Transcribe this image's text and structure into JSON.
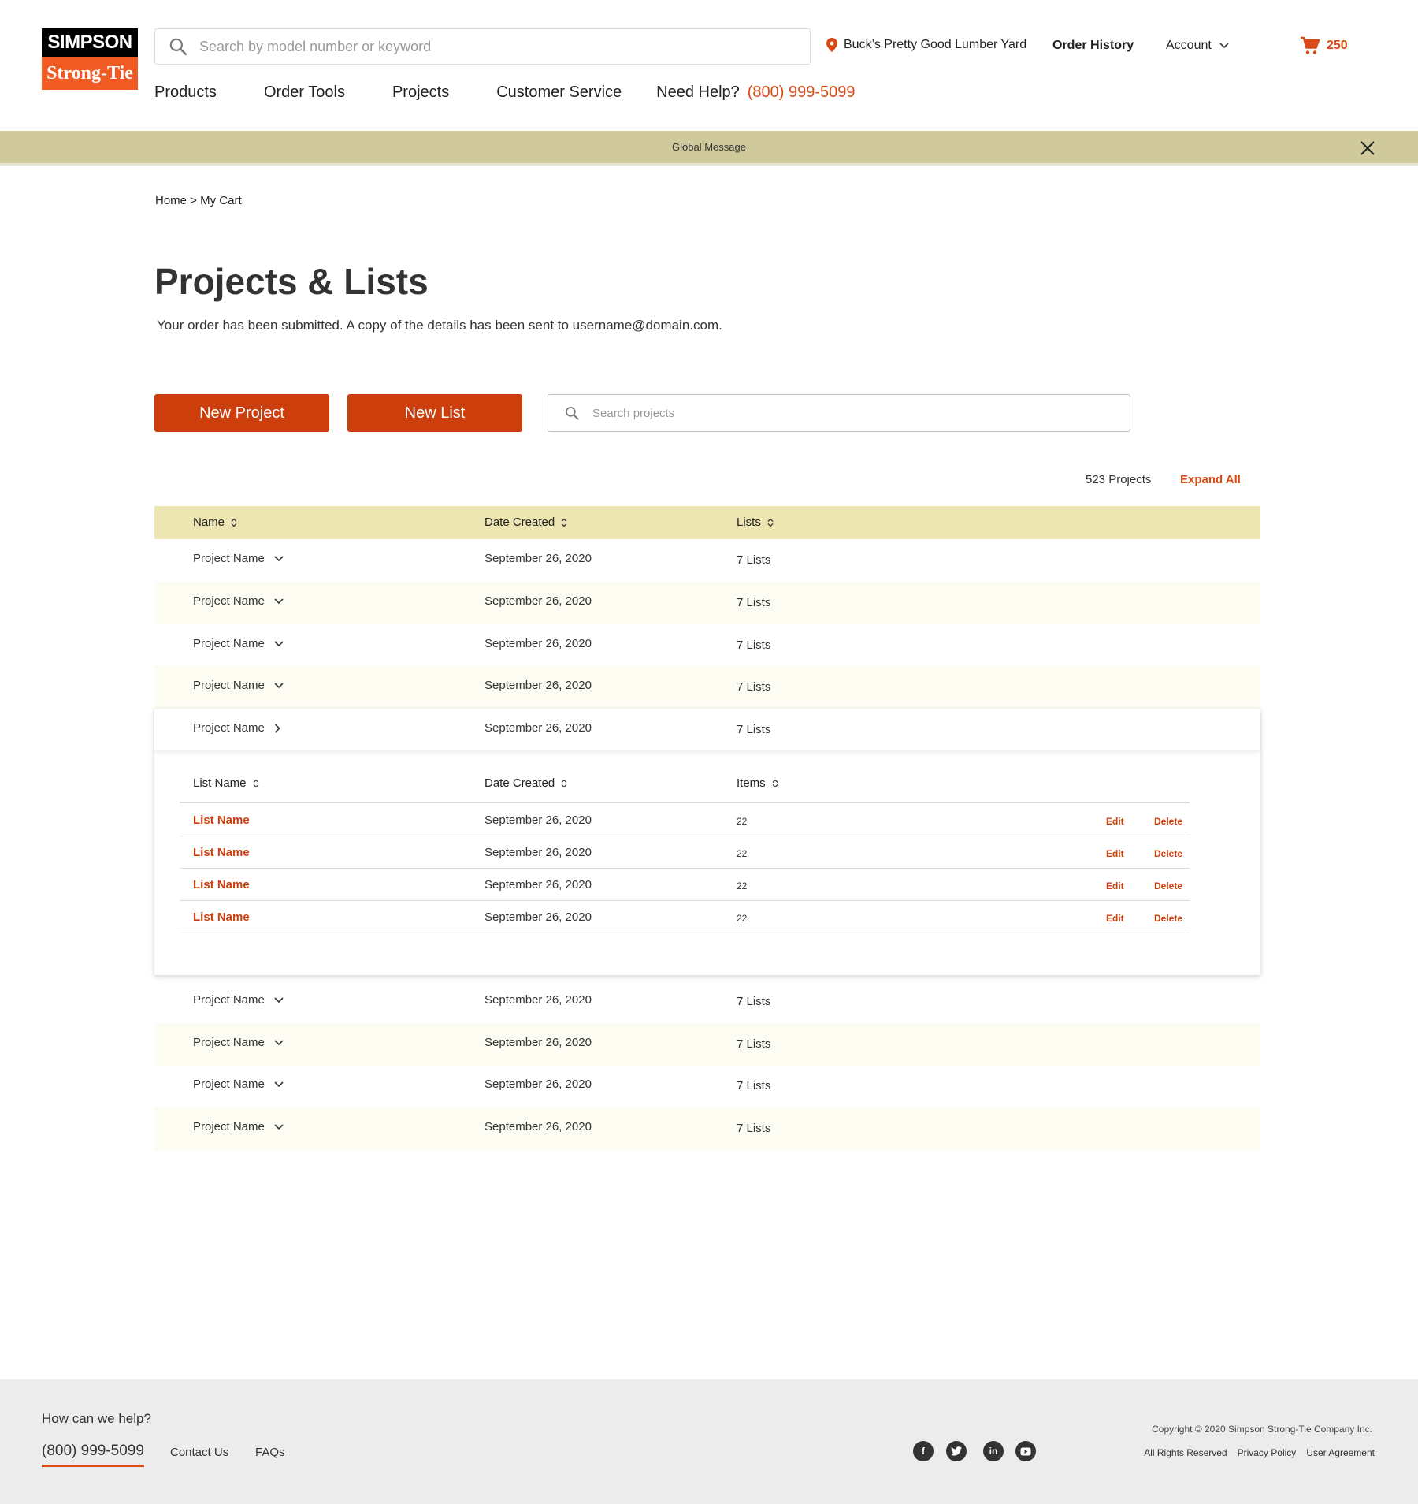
{
  "header": {
    "logo_top": "SIMPSON",
    "logo_bottom": "Strong-Tie",
    "search_placeholder": "Search by model number or keyword",
    "store_name": "Buck’s Pretty Good Lumber Yard",
    "order_history": "Order History",
    "account": "Account",
    "cart_count": "250",
    "nav": {
      "products": "Products",
      "order_tools": "Order Tools",
      "projects": "Projects",
      "customer_service": "Customer Service",
      "need_help": "Need Help?",
      "phone": "(800) 999-5099"
    }
  },
  "global_message": "Global Message",
  "breadcrumb": "Home > My Cart",
  "page": {
    "title": "Projects & Lists",
    "subtitle": "Your order has been submitted. A copy of the details has been sent to username@domain.com.",
    "new_project": "New Project",
    "new_list": "New List",
    "search_placeholder": "Search projects",
    "project_count": "523 Projects",
    "expand_all": "Expand All"
  },
  "table": {
    "headers": {
      "name": "Name",
      "date": "Date Created",
      "lists": "Lists"
    },
    "rows": [
      {
        "name": "Project Name",
        "date": "September 26, 2020",
        "lists": "7 Lists"
      },
      {
        "name": "Project Name",
        "date": "September 26, 2020",
        "lists": "7 Lists"
      },
      {
        "name": "Project Name",
        "date": "September 26, 2020",
        "lists": "7 Lists"
      },
      {
        "name": "Project Name",
        "date": "September 26, 2020",
        "lists": "7 Lists"
      },
      {
        "name": "Project Name",
        "date": "September 26, 2020",
        "lists": "7 Lists"
      },
      {
        "name": "Project Name",
        "date": "September 26, 2020",
        "lists": "7 Lists"
      },
      {
        "name": "Project Name",
        "date": "September 26, 2020",
        "lists": "7 Lists"
      },
      {
        "name": "Project Name",
        "date": "September 26, 2020",
        "lists": "7 Lists"
      },
      {
        "name": "Project Name",
        "date": "September 26, 2020",
        "lists": "7 Lists"
      }
    ],
    "sub_headers": {
      "name": "List Name",
      "date": "Date Created",
      "items": "Items"
    },
    "sub_rows": [
      {
        "name": "List Name",
        "date": "September 26, 2020",
        "items": "22",
        "edit": "Edit",
        "delete": "Delete"
      },
      {
        "name": "List Name",
        "date": "September 26, 2020",
        "items": "22",
        "edit": "Edit",
        "delete": "Delete"
      },
      {
        "name": "List Name",
        "date": "September 26, 2020",
        "items": "22",
        "edit": "Edit",
        "delete": "Delete"
      },
      {
        "name": "List Name",
        "date": "September 26, 2020",
        "items": "22",
        "edit": "Edit",
        "delete": "Delete"
      }
    ]
  },
  "footer": {
    "help": "How can we help?",
    "phone": "(800) 999-5099",
    "contact": "Contact Us",
    "faqs": "FAQs",
    "copyright": "Copyright © 2020 Simpson Strong-Tie Company Inc.",
    "rights": "All Rights Reserved",
    "privacy": "Privacy Policy",
    "agreement": "User Agreement",
    "social": {
      "facebook": "f",
      "linkedin": "in"
    }
  },
  "colors": {
    "accent": "#cc3f0c",
    "brand_orange": "#f15a22",
    "message_bar": "#cfc99c",
    "table_header": "#ede5b2"
  },
  "icons": [
    "search-icon",
    "location-pin-icon",
    "chevron-down-icon",
    "cart-icon",
    "close-icon",
    "sort-icon",
    "chevron-right-icon",
    "facebook-icon",
    "twitter-icon",
    "linkedin-icon",
    "youtube-icon"
  ]
}
